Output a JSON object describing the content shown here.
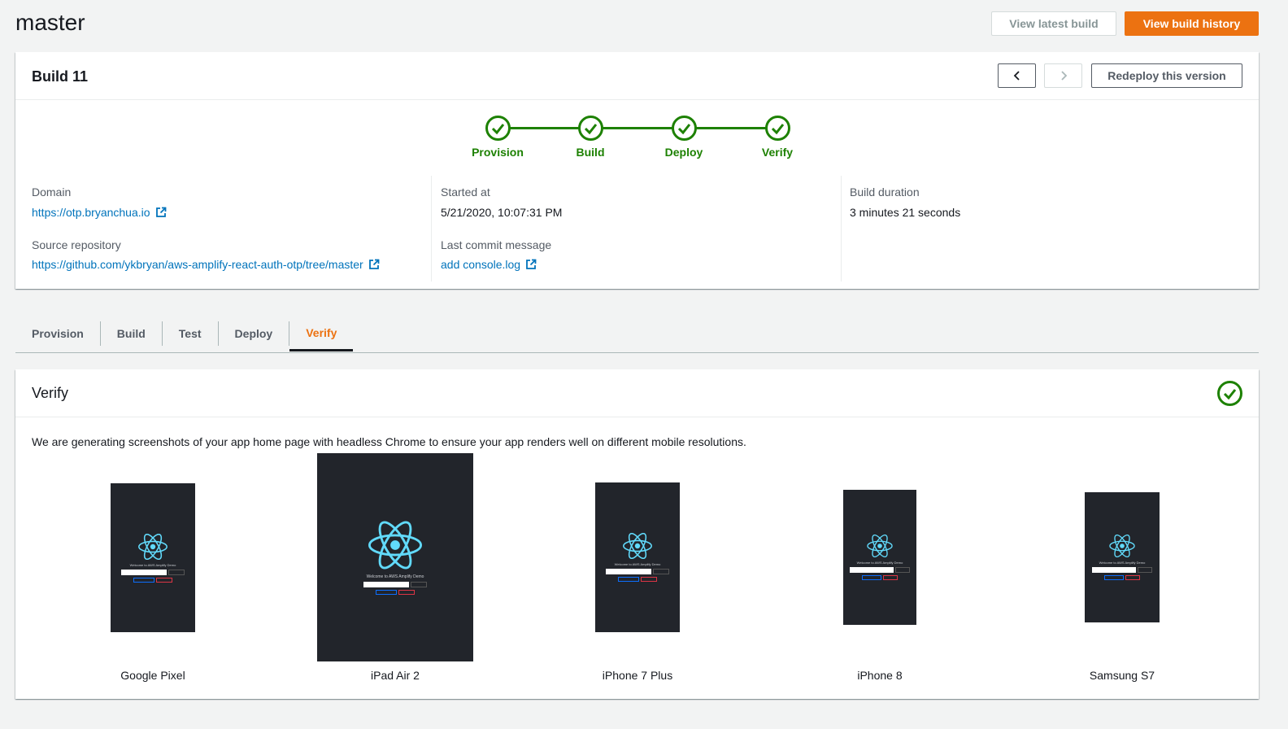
{
  "page": {
    "title": "master",
    "view_latest_label": "View latest build",
    "view_history_label": "View build history"
  },
  "build": {
    "title": "Build 11",
    "redeploy_label": "Redeploy this version",
    "steps": [
      {
        "label": "Provision",
        "status": "success"
      },
      {
        "label": "Build",
        "status": "success"
      },
      {
        "label": "Deploy",
        "status": "success"
      },
      {
        "label": "Verify",
        "status": "success"
      }
    ],
    "domain_label": "Domain",
    "domain_value": "https://otp.bryanchua.io",
    "repo_label": "Source repository",
    "repo_value": "https://github.com/ykbryan/aws-amplify-react-auth-otp/tree/master",
    "started_label": "Started at",
    "started_value": "5/21/2020, 10:07:31 PM",
    "commit_label": "Last commit message",
    "commit_value": "add console.log",
    "duration_label": "Build duration",
    "duration_value": "3 minutes 21 seconds"
  },
  "tabs": [
    "Provision",
    "Build",
    "Test",
    "Deploy",
    "Verify"
  ],
  "active_tab": "Verify",
  "verify": {
    "title": "Verify",
    "description": "We are generating screenshots of your app home page with headless Chrome to ensure your app renders well on different mobile resolutions.",
    "devices": [
      {
        "name": "Google Pixel",
        "screen_title": "Welcome to AWS Amplify Demo",
        "placeholder": "Phone Number (+XX)",
        "btn_get": "Get OTP",
        "btn_verify": "Verify Sign In",
        "btn_signout": "Sign Out"
      },
      {
        "name": "iPad Air 2",
        "screen_title": "Welcome to AWS Amplify Demo",
        "placeholder": "Phone Number (+XX)",
        "btn_get": "Get OTP",
        "btn_verify": "Verify Sign In",
        "btn_signout": "Sign Out"
      },
      {
        "name": "iPhone 7 Plus",
        "screen_title": "Welcome to AWS Amplify Demo",
        "placeholder": "Phone Number (+XX)",
        "btn_get": "Get OTP",
        "btn_verify": "Verify Sign In",
        "btn_signout": "Sign Out"
      },
      {
        "name": "iPhone 8",
        "screen_title": "Welcome to AWS Amplify Demo",
        "placeholder": "Phone Number (+XX)",
        "btn_get": "Get OTP",
        "btn_verify": "Verify Sign In",
        "btn_signout": "Sign Out"
      },
      {
        "name": "Samsung S7",
        "screen_title": "Welcome to AWS Amplify Demo",
        "placeholder": "Phone Number (+XX)",
        "btn_get": "Get OTP",
        "btn_verify": "Verify Sign In",
        "btn_signout": "Sign Out"
      }
    ]
  },
  "colors": {
    "accent": "#ec7211",
    "success": "#1d8102",
    "link": "#0073bb",
    "react": "#61dafb"
  }
}
